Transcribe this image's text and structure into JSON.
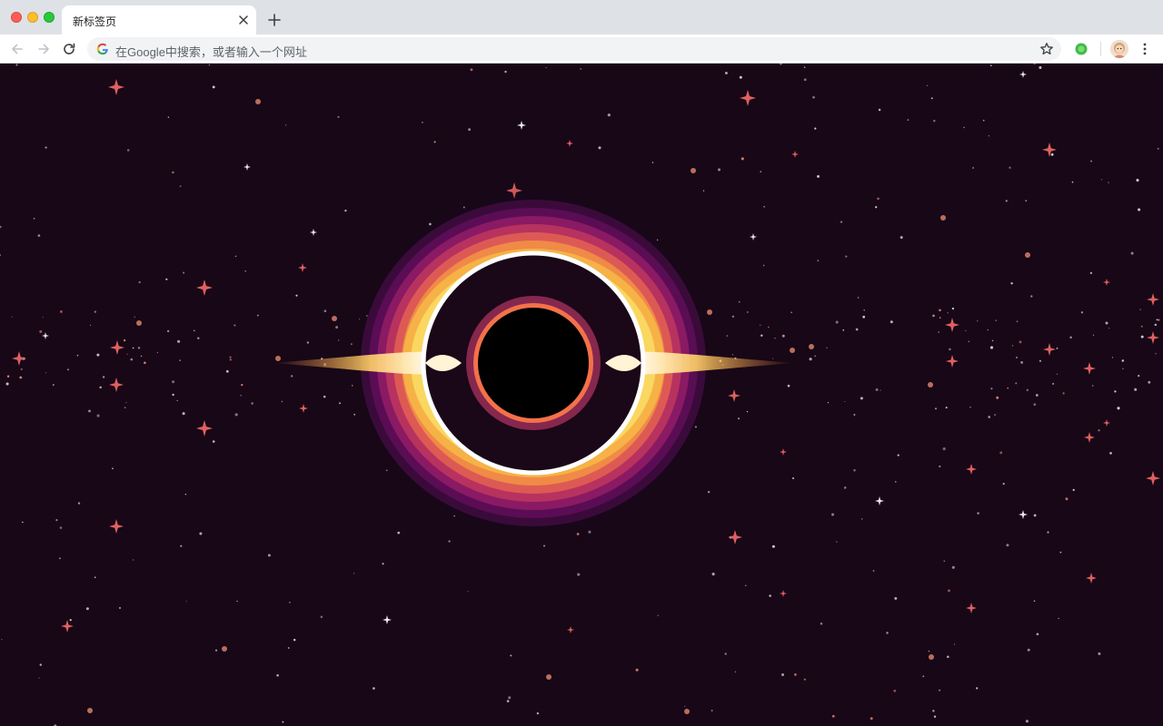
{
  "window": {
    "tab_title": "新标签页",
    "omnibox_placeholder": "在Google中搜索，或者输入一个网址"
  },
  "icons": {
    "back": "arrow-left-icon",
    "forward": "arrow-right-icon",
    "reload": "reload-icon",
    "bookmark": "star-icon",
    "extension": "extension-icon",
    "profile": "avatar",
    "menu": "kebab-menu-icon",
    "new_tab": "plus-icon",
    "tab_close": "close-icon"
  },
  "colors": {
    "background": "#170717",
    "ring": "#ffffff",
    "disk_outer": "#5a0d54",
    "disk_mid": "#c83a5c",
    "disk_inner": "#ffb35c"
  }
}
